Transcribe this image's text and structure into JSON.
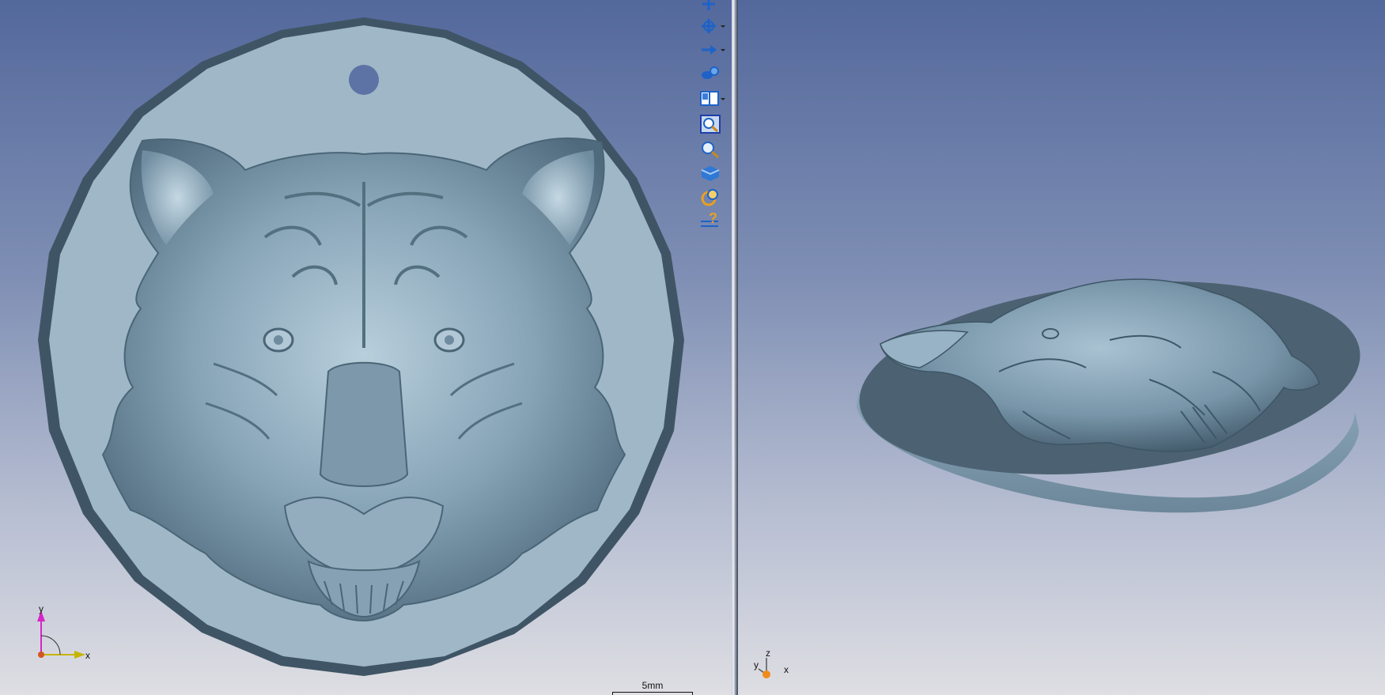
{
  "toolbar": {
    "tools": [
      {
        "name": "rotate-view-icon",
        "has_dropdown": false
      },
      {
        "name": "rotate-axis-icon",
        "has_dropdown": true
      },
      {
        "name": "pan-view-icon",
        "has_dropdown": true
      },
      {
        "name": "zoom-dynamic-icon",
        "has_dropdown": false
      },
      {
        "name": "view-layout-icon",
        "has_dropdown": true
      },
      {
        "name": "zoom-window-icon",
        "has_dropdown": false
      },
      {
        "name": "zoom-icon",
        "has_dropdown": false
      },
      {
        "name": "shaded-view-icon",
        "has_dropdown": false
      },
      {
        "name": "render-options-icon",
        "has_dropdown": false
      },
      {
        "name": "help-icon",
        "has_dropdown": false
      }
    ]
  },
  "scale": {
    "label": "5mm"
  },
  "left_view": {
    "axes": {
      "y": "y",
      "x": "x"
    }
  },
  "right_view": {
    "axes": {
      "z": "z",
      "y": "y",
      "x": "x"
    }
  },
  "colors": {
    "model": "#8aa6b8",
    "model_dark": "#5b7789",
    "background_top": "#53689c",
    "background_bottom": "#dedee3"
  }
}
